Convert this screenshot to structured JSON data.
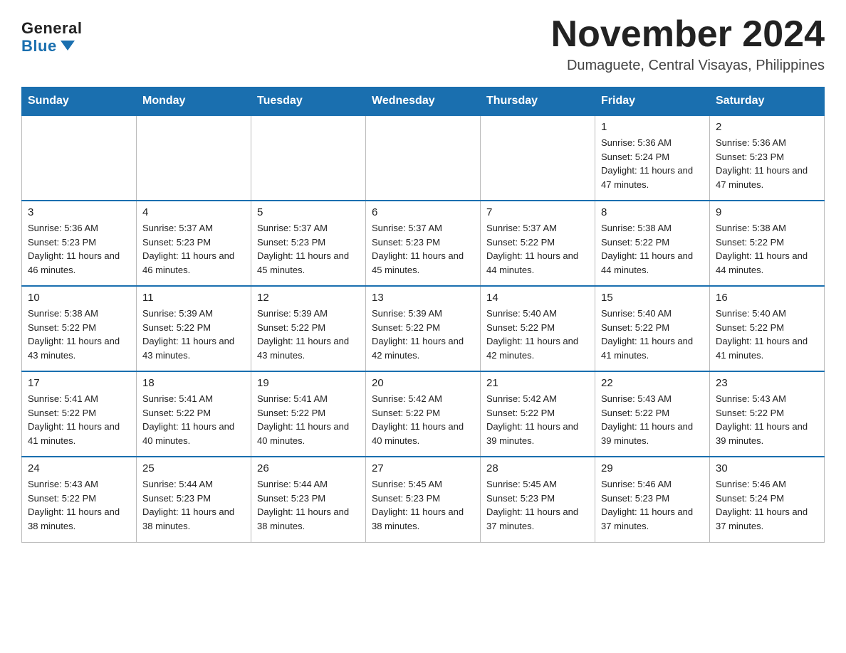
{
  "header": {
    "logo_general": "General",
    "logo_blue": "Blue",
    "month_title": "November 2024",
    "location": "Dumaguete, Central Visayas, Philippines"
  },
  "weekdays": [
    "Sunday",
    "Monday",
    "Tuesday",
    "Wednesday",
    "Thursday",
    "Friday",
    "Saturday"
  ],
  "weeks": [
    [
      {
        "day": "",
        "info": ""
      },
      {
        "day": "",
        "info": ""
      },
      {
        "day": "",
        "info": ""
      },
      {
        "day": "",
        "info": ""
      },
      {
        "day": "",
        "info": ""
      },
      {
        "day": "1",
        "info": "Sunrise: 5:36 AM\nSunset: 5:24 PM\nDaylight: 11 hours and 47 minutes."
      },
      {
        "day": "2",
        "info": "Sunrise: 5:36 AM\nSunset: 5:23 PM\nDaylight: 11 hours and 47 minutes."
      }
    ],
    [
      {
        "day": "3",
        "info": "Sunrise: 5:36 AM\nSunset: 5:23 PM\nDaylight: 11 hours and 46 minutes."
      },
      {
        "day": "4",
        "info": "Sunrise: 5:37 AM\nSunset: 5:23 PM\nDaylight: 11 hours and 46 minutes."
      },
      {
        "day": "5",
        "info": "Sunrise: 5:37 AM\nSunset: 5:23 PM\nDaylight: 11 hours and 45 minutes."
      },
      {
        "day": "6",
        "info": "Sunrise: 5:37 AM\nSunset: 5:23 PM\nDaylight: 11 hours and 45 minutes."
      },
      {
        "day": "7",
        "info": "Sunrise: 5:37 AM\nSunset: 5:22 PM\nDaylight: 11 hours and 44 minutes."
      },
      {
        "day": "8",
        "info": "Sunrise: 5:38 AM\nSunset: 5:22 PM\nDaylight: 11 hours and 44 minutes."
      },
      {
        "day": "9",
        "info": "Sunrise: 5:38 AM\nSunset: 5:22 PM\nDaylight: 11 hours and 44 minutes."
      }
    ],
    [
      {
        "day": "10",
        "info": "Sunrise: 5:38 AM\nSunset: 5:22 PM\nDaylight: 11 hours and 43 minutes."
      },
      {
        "day": "11",
        "info": "Sunrise: 5:39 AM\nSunset: 5:22 PM\nDaylight: 11 hours and 43 minutes."
      },
      {
        "day": "12",
        "info": "Sunrise: 5:39 AM\nSunset: 5:22 PM\nDaylight: 11 hours and 43 minutes."
      },
      {
        "day": "13",
        "info": "Sunrise: 5:39 AM\nSunset: 5:22 PM\nDaylight: 11 hours and 42 minutes."
      },
      {
        "day": "14",
        "info": "Sunrise: 5:40 AM\nSunset: 5:22 PM\nDaylight: 11 hours and 42 minutes."
      },
      {
        "day": "15",
        "info": "Sunrise: 5:40 AM\nSunset: 5:22 PM\nDaylight: 11 hours and 41 minutes."
      },
      {
        "day": "16",
        "info": "Sunrise: 5:40 AM\nSunset: 5:22 PM\nDaylight: 11 hours and 41 minutes."
      }
    ],
    [
      {
        "day": "17",
        "info": "Sunrise: 5:41 AM\nSunset: 5:22 PM\nDaylight: 11 hours and 41 minutes."
      },
      {
        "day": "18",
        "info": "Sunrise: 5:41 AM\nSunset: 5:22 PM\nDaylight: 11 hours and 40 minutes."
      },
      {
        "day": "19",
        "info": "Sunrise: 5:41 AM\nSunset: 5:22 PM\nDaylight: 11 hours and 40 minutes."
      },
      {
        "day": "20",
        "info": "Sunrise: 5:42 AM\nSunset: 5:22 PM\nDaylight: 11 hours and 40 minutes."
      },
      {
        "day": "21",
        "info": "Sunrise: 5:42 AM\nSunset: 5:22 PM\nDaylight: 11 hours and 39 minutes."
      },
      {
        "day": "22",
        "info": "Sunrise: 5:43 AM\nSunset: 5:22 PM\nDaylight: 11 hours and 39 minutes."
      },
      {
        "day": "23",
        "info": "Sunrise: 5:43 AM\nSunset: 5:22 PM\nDaylight: 11 hours and 39 minutes."
      }
    ],
    [
      {
        "day": "24",
        "info": "Sunrise: 5:43 AM\nSunset: 5:22 PM\nDaylight: 11 hours and 38 minutes."
      },
      {
        "day": "25",
        "info": "Sunrise: 5:44 AM\nSunset: 5:23 PM\nDaylight: 11 hours and 38 minutes."
      },
      {
        "day": "26",
        "info": "Sunrise: 5:44 AM\nSunset: 5:23 PM\nDaylight: 11 hours and 38 minutes."
      },
      {
        "day": "27",
        "info": "Sunrise: 5:45 AM\nSunset: 5:23 PM\nDaylight: 11 hours and 38 minutes."
      },
      {
        "day": "28",
        "info": "Sunrise: 5:45 AM\nSunset: 5:23 PM\nDaylight: 11 hours and 37 minutes."
      },
      {
        "day": "29",
        "info": "Sunrise: 5:46 AM\nSunset: 5:23 PM\nDaylight: 11 hours and 37 minutes."
      },
      {
        "day": "30",
        "info": "Sunrise: 5:46 AM\nSunset: 5:24 PM\nDaylight: 11 hours and 37 minutes."
      }
    ]
  ]
}
